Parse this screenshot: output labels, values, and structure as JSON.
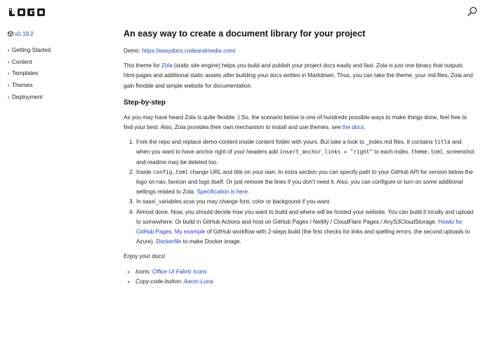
{
  "header": {
    "logo_text": "LOGO",
    "search_icon": "search-icon"
  },
  "sidebar": {
    "version": "v0.19.2",
    "items": [
      {
        "label": "Getting Started"
      },
      {
        "label": "Content"
      },
      {
        "label": "Templates"
      },
      {
        "label": "Themes"
      },
      {
        "label": "Deployment"
      }
    ]
  },
  "main": {
    "title": "An easy way to create a document library for your project",
    "demo_label": "Demo: ",
    "demo_link": "https://easydocs.codeandmedia.com/",
    "intro_1": "This theme for ",
    "intro_zola": "Zola",
    "intro_2": " (static site engine) helps you build and publish your project docs easily and fast. Zola is just one binary that outputs html-pages and additional static assets after building your docs written in Markdown. Thus, you can take the theme, your md-files, Zola and gain flexible and simple website for documentation.",
    "step_heading": "Step-by-step",
    "para2_1": "As you may have heard Zola is quite flexible :) So, the scenario below is one of hundreds possible ways to make things done, feel free to find your best. Also, Zola provides their own mechanism to install and use themes, see ",
    "para2_link": "the docs",
    "para2_2": ".",
    "step1_a": "Fork the repo and replace demo-content inside content folder with yours. But take a look to _index.md files. It contains ",
    "step1_code1": "title",
    "step1_b": " and when you want to have anchor right of your headers add ",
    "step1_code2": "insert_anchor_links = \"right\"",
    "step1_c": " to each index. ",
    "step1_code3": "theme.toml",
    "step1_d": ", screenshot and readme may be deleted too.",
    "step2_a": "Inside ",
    "step2_code": "config.toml",
    "step2_b": " change URL and title on your own. In extra section you can specify path to your GitHub API for version below the logo on nav, favicon and logo itself. Or just remove the lines if you don't need it. Also, you can configure or turn on some additional settings related to Zola. ",
    "step2_link": "Specification is here",
    "step2_c": ".",
    "step3": "In sass/_variables.scss you may change font, color or backgound if you want.",
    "step4_a": "Almost done. Now, you should decide how you want to build and where will be hosted your website. You can build it locally and upload to somewhere. Or build in GitHub Actions and host on GitHub Pages / Netlify / CloudFlare Pages / AnyS3CloudStorage. ",
    "step4_link1": "Howto for GitHub Pages",
    "step4_b": ". ",
    "step4_link2": "My example",
    "step4_c": " of GitHub workflow with 2-steps build (the first checks for links and spelling errors, the second uploads to Azure). ",
    "step4_link3": "Dockerfile",
    "step4_d": " to make Docker image.",
    "enjoy": "Enjoy your docs!",
    "credit1_label": "Icons: ",
    "credit1_link": "Office UI Fabric Icons",
    "credit2_label": "Copy-code-button: ",
    "credit2_link": "Aaron Luna"
  },
  "colors": {
    "link": "#1a3fd4",
    "text": "#222222",
    "background": "#ffffff"
  }
}
